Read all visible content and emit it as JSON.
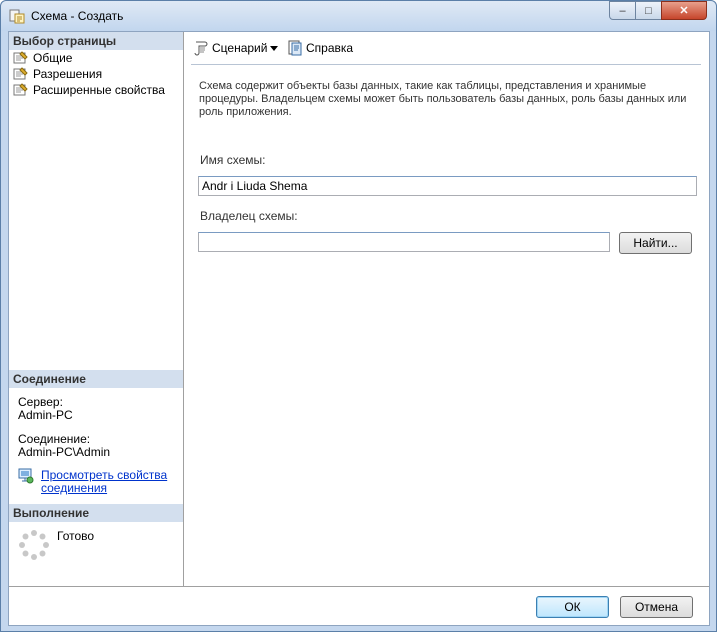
{
  "window": {
    "title": "Схема - Создать",
    "minimize": "–",
    "maximize": "□",
    "close": "✕"
  },
  "left_panel": {
    "select_page_header": "Выбор страницы",
    "pages": [
      {
        "label": "Общие"
      },
      {
        "label": "Разрешения"
      },
      {
        "label": "Расширенные свойства"
      }
    ],
    "connection_header": "Соединение",
    "server_label": "Сервер:",
    "server_value": "Admin-PC",
    "connection_label": "Соединение:",
    "connection_value": "Admin-PC\\Admin",
    "view_props_link_line1": "Просмотреть свойства",
    "view_props_link_line2": "соединения",
    "progress_header": "Выполнение",
    "progress_status": "Готово"
  },
  "toolbar": {
    "script_label": "Сценарий",
    "help_label": "Справка"
  },
  "main": {
    "description": "Схема содержит объекты базы данных, такие как таблицы, представления и хранимые процедуры. Владельцем схемы может быть пользователь базы данных, роль базы данных или роль приложения.",
    "schema_name_label": "Имя схемы:",
    "schema_name_value": "Andr i Liuda Shema",
    "schema_owner_label": "Владелец схемы:",
    "schema_owner_value": "",
    "find_button": "Найти..."
  },
  "footer": {
    "ok": "ОК",
    "cancel": "Отмена"
  },
  "colors": {
    "section_header_bg": "#d3dfee",
    "link": "#0033cc",
    "window_frame": "#c4d7ee"
  }
}
